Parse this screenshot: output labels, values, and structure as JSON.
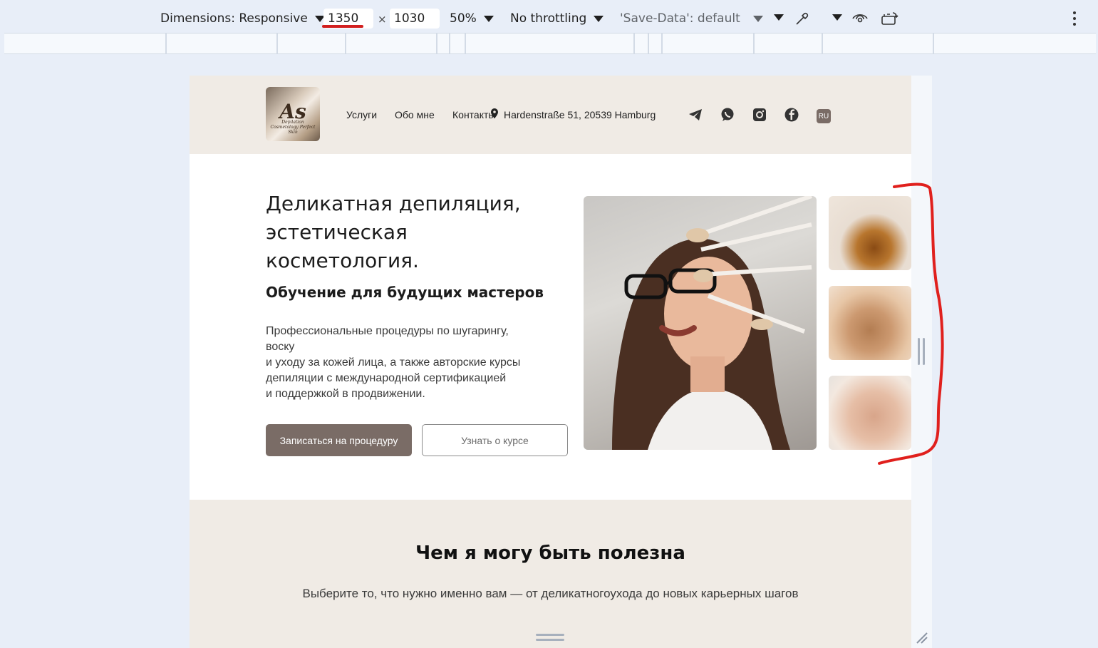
{
  "devtools": {
    "dimensions_label": "Dimensions: Responsive",
    "width_value": "1350",
    "times_sign": "×",
    "height_value": "1030",
    "zoom": "50%",
    "throttling": "No throttling",
    "save_data": "'Save-Data': default",
    "annotation_color": "#d21f1f"
  },
  "site": {
    "logo_text": "As",
    "logo_subtext": "Depilation Cosmetology Perfect Skin",
    "nav": {
      "services": "Услуги",
      "about": "Обо мне",
      "contacts": "Контакты",
      "address": "Hardenstraße 51, 20539 Hamburg"
    },
    "lang": "RU",
    "social_icons": [
      "telegram-icon",
      "whatsapp-icon",
      "instagram-icon",
      "facebook-icon"
    ],
    "brand_color": "#7a6c66",
    "section_bg": "#f0ebe5"
  },
  "hero": {
    "title": "Деликатная депиляция, эстетическая косметология.",
    "subtitle": "Обучение для будущих мастеров",
    "description": "Профессиональные процедуры по шугарингу,\nвоску\nи уходу за кожей лица, а также авторские курсы\nдепиляции с международной сертификацией\nи поддержкой в продвижении.",
    "primary_button": "Записаться на процедуру",
    "secondary_button": "Узнать о курсе"
  },
  "services": {
    "title": "Чем я могу быть полезна",
    "description": "Выберите то, что нужно именно вам — от деликатногоухода до новых карьерных шагов"
  }
}
